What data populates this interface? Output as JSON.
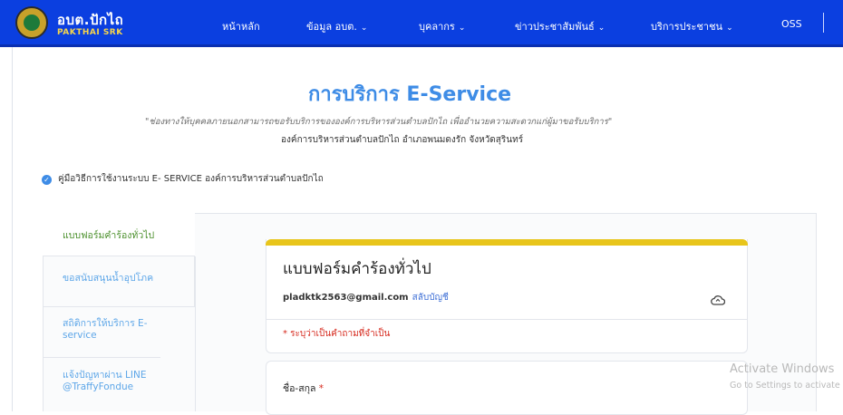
{
  "header": {
    "brand_title": "อบต.ปักไถ",
    "brand_subtitle": "PAKTHAI SRK",
    "nav": [
      {
        "label": "หน้าหลัก",
        "has_dropdown": false
      },
      {
        "label": "ข้อมูล อบต.",
        "has_dropdown": true
      },
      {
        "label": "บุคลากร",
        "has_dropdown": true
      },
      {
        "label": "ข่าวประชาสัมพันธ์",
        "has_dropdown": true
      },
      {
        "label": "บริการประชาชน",
        "has_dropdown": true
      },
      {
        "label": "OSS",
        "has_dropdown": false
      }
    ],
    "chevron_glyph": "⌄"
  },
  "main": {
    "title": "การบริการ E-Service",
    "description": "\"ช่องทางให้บุคคลภายนอกสามารถขอรับบริการขององค์การบริหารส่วนตำบลปักไถ เพื่ออำนวยความสะดวกแก่ผู้มาขอรับบริการ\"",
    "organization": "องค์การบริหารส่วนตำบลปักไถ อำเภอพนมดงรัก จังหวัดสุรินทร์",
    "guide_link": "คู่มือวิธีการใช้งานระบบ E- SERVICE องค์การบริหารส่วนตำบลปักไถ"
  },
  "side_tabs": [
    {
      "label": "แบบฟอร์มคำร้องทั่วไป",
      "active": true
    },
    {
      "label": "ขอสนับสนุนน้ำอุปโภค",
      "active": false
    },
    {
      "label": "สถิติการให้บริการ E-service",
      "active": false
    },
    {
      "label": "แจ้งปัญหาผ่าน LINE @TraffyFondue",
      "active": false
    }
  ],
  "form": {
    "title": "แบบฟอร์มคำร้องทั่วไป",
    "email": "pladktk2563@gmail.com",
    "switch_account": "สลับบัญชี",
    "required_note": "* ระบุว่าเป็นคำถามที่จำเป็น",
    "field_label": "ชื่อ-สกุล",
    "field_required_mark": "*"
  },
  "watermark": {
    "line1": "Activate Windows",
    "line2": "Go to Settings to activate Windows."
  },
  "colors": {
    "nav_bg": "#0b3fe0",
    "title": "#3e8ce6",
    "form_accent": "#e8c51b",
    "active_tab": "#4a8f2b",
    "tab_link": "#5da6e8",
    "required": "#d6291d"
  }
}
